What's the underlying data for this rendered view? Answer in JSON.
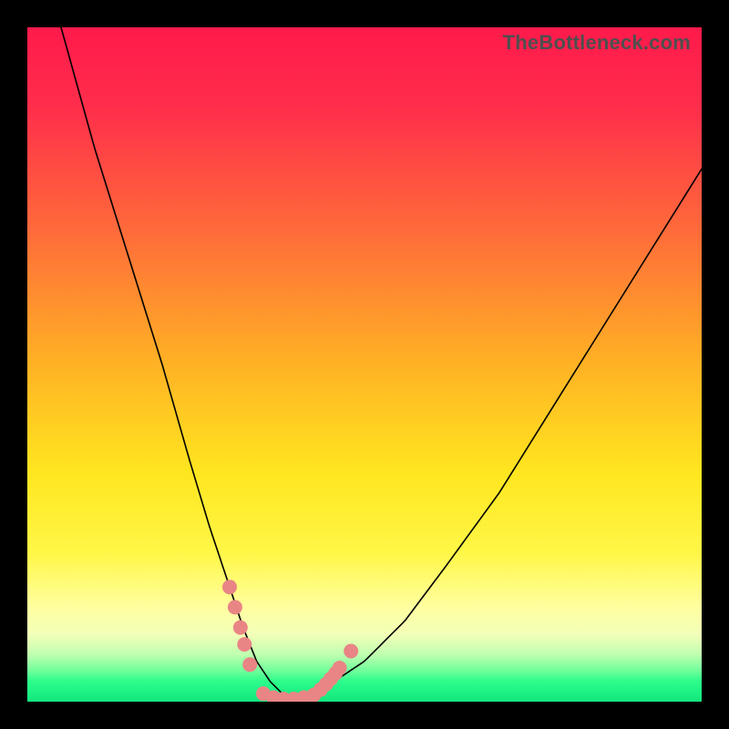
{
  "watermark": "TheBottleneck.com",
  "chart_data": {
    "type": "line",
    "title": "",
    "xlabel": "",
    "ylabel": "",
    "xlim": [
      0,
      100
    ],
    "ylim": [
      0,
      100
    ],
    "background_gradient_stops": [
      {
        "pct": 0,
        "color": "#ff1a4b"
      },
      {
        "pct": 12,
        "color": "#ff2e4b"
      },
      {
        "pct": 30,
        "color": "#ff6a3a"
      },
      {
        "pct": 50,
        "color": "#ffb224"
      },
      {
        "pct": 66,
        "color": "#ffe61f"
      },
      {
        "pct": 78,
        "color": "#fff747"
      },
      {
        "pct": 86,
        "color": "#ffffa0"
      },
      {
        "pct": 90,
        "color": "#f3ffb8"
      },
      {
        "pct": 93,
        "color": "#c0ffb0"
      },
      {
        "pct": 95.5,
        "color": "#6dff9a"
      },
      {
        "pct": 97,
        "color": "#2cfd8b"
      },
      {
        "pct": 100,
        "color": "#12e77e"
      }
    ],
    "series": [
      {
        "name": "bottleneck-curve",
        "color": "#000000",
        "stroke_width": 1.6,
        "x": [
          5,
          10,
          15,
          20,
          24,
          27,
          30,
          32,
          34,
          36,
          38,
          40,
          44,
          50,
          56,
          62,
          70,
          80,
          90,
          100
        ],
        "y": [
          100,
          82,
          66,
          50,
          36,
          26,
          17,
          11,
          6,
          3,
          1,
          0,
          2,
          6,
          12,
          20,
          31,
          47,
          63,
          79
        ]
      }
    ],
    "markers": {
      "name": "highlight-dots",
      "color": "#e98585",
      "radius": 8,
      "points": [
        {
          "x": 30.0,
          "y": 17.0
        },
        {
          "x": 30.8,
          "y": 14.0
        },
        {
          "x": 31.6,
          "y": 11.0
        },
        {
          "x": 32.2,
          "y": 8.5
        },
        {
          "x": 33.0,
          "y": 5.5
        },
        {
          "x": 35.0,
          "y": 1.2
        },
        {
          "x": 36.5,
          "y": 0.6
        },
        {
          "x": 38.0,
          "y": 0.4
        },
        {
          "x": 39.5,
          "y": 0.4
        },
        {
          "x": 41.0,
          "y": 0.6
        },
        {
          "x": 42.5,
          "y": 1.0
        },
        {
          "x": 43.5,
          "y": 1.8
        },
        {
          "x": 44.3,
          "y": 2.6
        },
        {
          "x": 45.0,
          "y": 3.4
        },
        {
          "x": 45.7,
          "y": 4.2
        },
        {
          "x": 46.3,
          "y": 5.0
        },
        {
          "x": 48.0,
          "y": 7.5
        }
      ]
    }
  }
}
